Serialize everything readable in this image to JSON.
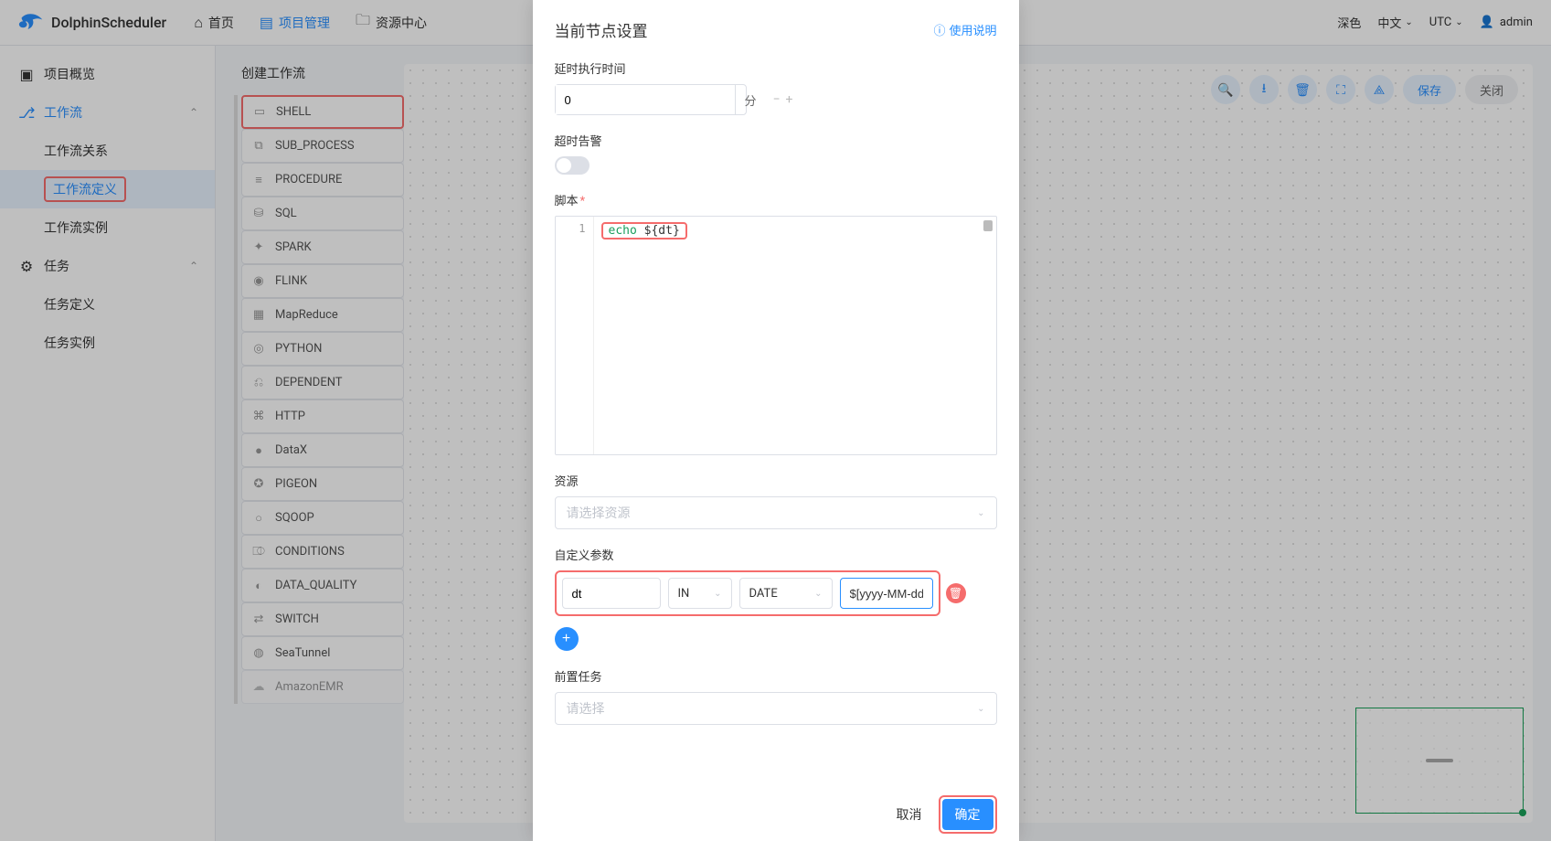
{
  "brand": "DolphinScheduler",
  "nav": {
    "home": "首页",
    "project": "项目管理",
    "resource": "资源中心"
  },
  "header_right": {
    "theme": "深色",
    "lang": "中文",
    "tz": "UTC",
    "user": "admin"
  },
  "sidebar": {
    "overview": "项目概览",
    "workflow": "工作流",
    "workflow_relation": "工作流关系",
    "workflow_definition": "工作流定义",
    "workflow_instance": "工作流实例",
    "task": "任务",
    "task_definition": "任务定义",
    "task_instance": "任务实例"
  },
  "palette": {
    "title": "创建工作流",
    "items": [
      "SHELL",
      "SUB_PROCESS",
      "PROCEDURE",
      "SQL",
      "SPARK",
      "FLINK",
      "MapReduce",
      "PYTHON",
      "DEPENDENT",
      "HTTP",
      "DataX",
      "PIGEON",
      "SQOOP",
      "CONDITIONS",
      "DATA_QUALITY",
      "SWITCH",
      "SeaTunnel",
      "AmazonEMR"
    ]
  },
  "toolbar": {
    "save": "保存",
    "close": "关闭"
  },
  "drawer": {
    "title": "当前节点设置",
    "help": "使用说明",
    "delay_label": "延时执行时间",
    "delay_value": "0",
    "delay_unit": "分",
    "timeout_label": "超时告警",
    "script_label": "脚本",
    "script_line1_echo": "echo",
    "script_line1_var": " ${dt}",
    "resource_label": "资源",
    "resource_placeholder": "请选择资源",
    "custom_param_label": "自定义参数",
    "param_name": "dt",
    "param_dir": "IN",
    "param_type": "DATE",
    "param_value": "$[yyyy-MM-dd]",
    "pre_task_label": "前置任务",
    "pre_task_placeholder": "请选择",
    "cancel": "取消",
    "confirm": "确定"
  }
}
